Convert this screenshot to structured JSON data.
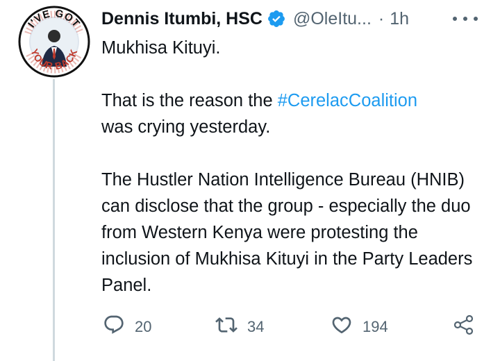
{
  "tweet": {
    "author": {
      "name": "Dennis Itumbi, HSC",
      "handle": "@OleItu...",
      "avatar_label": "I'VE GOT YOUR BACK"
    },
    "separator": "·",
    "time": "1h",
    "body": {
      "line1": "Mukhisa Kituyi.",
      "p2_pre": "That is the reason the ",
      "p2_hashtag": "#CerelacCoalition",
      "p2_post": "was crying yesterday.",
      "p3": "The Hustler Nation Intelligence Bureau (HNIB) can disclose that the group - especially the duo from Western Kenya were protesting the inclusion of Mukhisa Kituyi in the Party Leaders Panel."
    },
    "stats": {
      "replies": "20",
      "retweets": "34",
      "likes": "194"
    }
  },
  "icons": {
    "verified": "verified-badge-icon",
    "more": "more-options-icon",
    "reply": "reply-icon",
    "retweet": "retweet-icon",
    "like": "heart-icon",
    "share": "share-icon"
  },
  "colors": {
    "accent": "#1d9bf0",
    "muted": "#536471",
    "text": "#0f1419",
    "thread_line": "#cfd9de"
  }
}
